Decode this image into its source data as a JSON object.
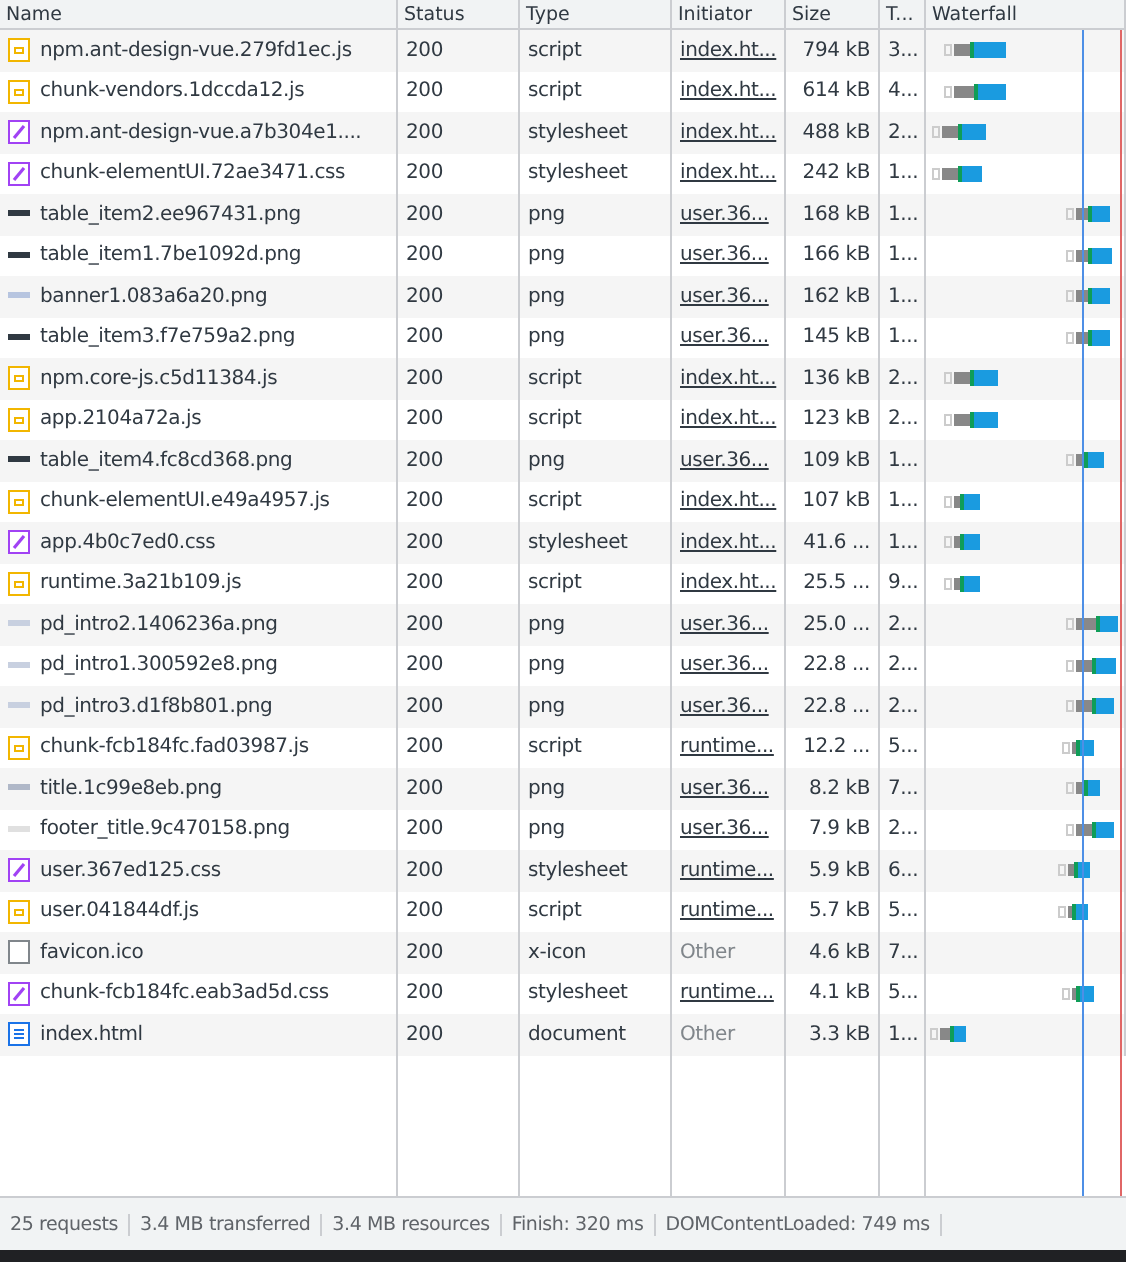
{
  "columns": [
    "Name",
    "Status",
    "Type",
    "Initiator",
    "Size",
    "T...",
    "Waterfall"
  ],
  "rows": [
    {
      "kind": "script",
      "name": "npm.ant-design-vue.279fd1ec.js",
      "status": "200",
      "type": "script",
      "initiator": "index.ht...",
      "initiator_link": true,
      "size": "794 kB",
      "time": "3..."
    },
    {
      "kind": "script",
      "name": "chunk-vendors.1dccda12.js",
      "status": "200",
      "type": "script",
      "initiator": "index.ht...",
      "initiator_link": true,
      "size": "614 kB",
      "time": "4..."
    },
    {
      "kind": "stylesheet",
      "name": "npm.ant-design-vue.a7b304e1....",
      "status": "200",
      "type": "stylesheet",
      "initiator": "index.ht...",
      "initiator_link": true,
      "size": "488 kB",
      "time": "2..."
    },
    {
      "kind": "stylesheet",
      "name": "chunk-elementUI.72ae3471.css",
      "status": "200",
      "type": "stylesheet",
      "initiator": "index.ht...",
      "initiator_link": true,
      "size": "242 kB",
      "time": "1..."
    },
    {
      "kind": "image",
      "name": "table_item2.ee967431.png",
      "status": "200",
      "type": "png",
      "initiator": "user.36...",
      "initiator_link": true,
      "size": "168 kB",
      "time": "1..."
    },
    {
      "kind": "image",
      "name": "table_item1.7be1092d.png",
      "status": "200",
      "type": "png",
      "initiator": "user.36...",
      "initiator_link": true,
      "size": "166 kB",
      "time": "1..."
    },
    {
      "kind": "image",
      "name": "banner1.083a6a20.png",
      "status": "200",
      "type": "png",
      "initiator": "user.36...",
      "initiator_link": true,
      "size": "162 kB",
      "time": "1..."
    },
    {
      "kind": "image",
      "name": "table_item3.f7e759a2.png",
      "status": "200",
      "type": "png",
      "initiator": "user.36...",
      "initiator_link": true,
      "size": "145 kB",
      "time": "1..."
    },
    {
      "kind": "script",
      "name": "npm.core-js.c5d11384.js",
      "status": "200",
      "type": "script",
      "initiator": "index.ht...",
      "initiator_link": true,
      "size": "136 kB",
      "time": "2..."
    },
    {
      "kind": "script",
      "name": "app.2104a72a.js",
      "status": "200",
      "type": "script",
      "initiator": "index.ht...",
      "initiator_link": true,
      "size": "123 kB",
      "time": "2..."
    },
    {
      "kind": "image",
      "name": "table_item4.fc8cd368.png",
      "status": "200",
      "type": "png",
      "initiator": "user.36...",
      "initiator_link": true,
      "size": "109 kB",
      "time": "1..."
    },
    {
      "kind": "script",
      "name": "chunk-elementUI.e49a4957.js",
      "status": "200",
      "type": "script",
      "initiator": "index.ht...",
      "initiator_link": true,
      "size": "107 kB",
      "time": "1..."
    },
    {
      "kind": "stylesheet",
      "name": "app.4b0c7ed0.css",
      "status": "200",
      "type": "stylesheet",
      "initiator": "index.ht...",
      "initiator_link": true,
      "size": "41.6 ...",
      "time": "1..."
    },
    {
      "kind": "script",
      "name": "runtime.3a21b109.js",
      "status": "200",
      "type": "script",
      "initiator": "index.ht...",
      "initiator_link": true,
      "size": "25.5 ...",
      "time": "9..."
    },
    {
      "kind": "image",
      "name": "pd_intro2.1406236a.png",
      "status": "200",
      "type": "png",
      "initiator": "user.36...",
      "initiator_link": true,
      "size": "25.0 ...",
      "time": "2..."
    },
    {
      "kind": "image",
      "name": "pd_intro1.300592e8.png",
      "status": "200",
      "type": "png",
      "initiator": "user.36...",
      "initiator_link": true,
      "size": "22.8 ...",
      "time": "2..."
    },
    {
      "kind": "image",
      "name": "pd_intro3.d1f8b801.png",
      "status": "200",
      "type": "png",
      "initiator": "user.36...",
      "initiator_link": true,
      "size": "22.8 ...",
      "time": "2..."
    },
    {
      "kind": "script",
      "name": "chunk-fcb184fc.fad03987.js",
      "status": "200",
      "type": "script",
      "initiator": "runtime...",
      "initiator_link": true,
      "size": "12.2 ...",
      "time": "5..."
    },
    {
      "kind": "image",
      "name": "title.1c99e8eb.png",
      "status": "200",
      "type": "png",
      "initiator": "user.36...",
      "initiator_link": true,
      "size": "8.2 kB",
      "time": "7..."
    },
    {
      "kind": "image",
      "name": "footer_title.9c470158.png",
      "status": "200",
      "type": "png",
      "initiator": "user.36...",
      "initiator_link": true,
      "size": "7.9 kB",
      "time": "2..."
    },
    {
      "kind": "stylesheet",
      "name": "user.367ed125.css",
      "status": "200",
      "type": "stylesheet",
      "initiator": "runtime...",
      "initiator_link": true,
      "size": "5.9 kB",
      "time": "6..."
    },
    {
      "kind": "script",
      "name": "user.041844df.js",
      "status": "200",
      "type": "script",
      "initiator": "runtime...",
      "initiator_link": true,
      "size": "5.7 kB",
      "time": "5..."
    },
    {
      "kind": "icon",
      "name": "favicon.ico",
      "status": "200",
      "type": "x-icon",
      "initiator": "Other",
      "initiator_link": false,
      "size": "4.6 kB",
      "time": "7..."
    },
    {
      "kind": "stylesheet",
      "name": "chunk-fcb184fc.eab3ad5d.css",
      "status": "200",
      "type": "stylesheet",
      "initiator": "runtime...",
      "initiator_link": true,
      "size": "4.1 kB",
      "time": "5..."
    },
    {
      "kind": "document",
      "name": "index.html",
      "status": "200",
      "type": "document",
      "initiator": "Other",
      "initiator_link": false,
      "size": "3.3 kB",
      "time": "1..."
    }
  ],
  "status_bar": [
    "25 requests",
    "3.4 MB transferred",
    "3.4 MB resources",
    "Finish: 320 ms",
    "DOMContentLoaded: 749 ms"
  ]
}
